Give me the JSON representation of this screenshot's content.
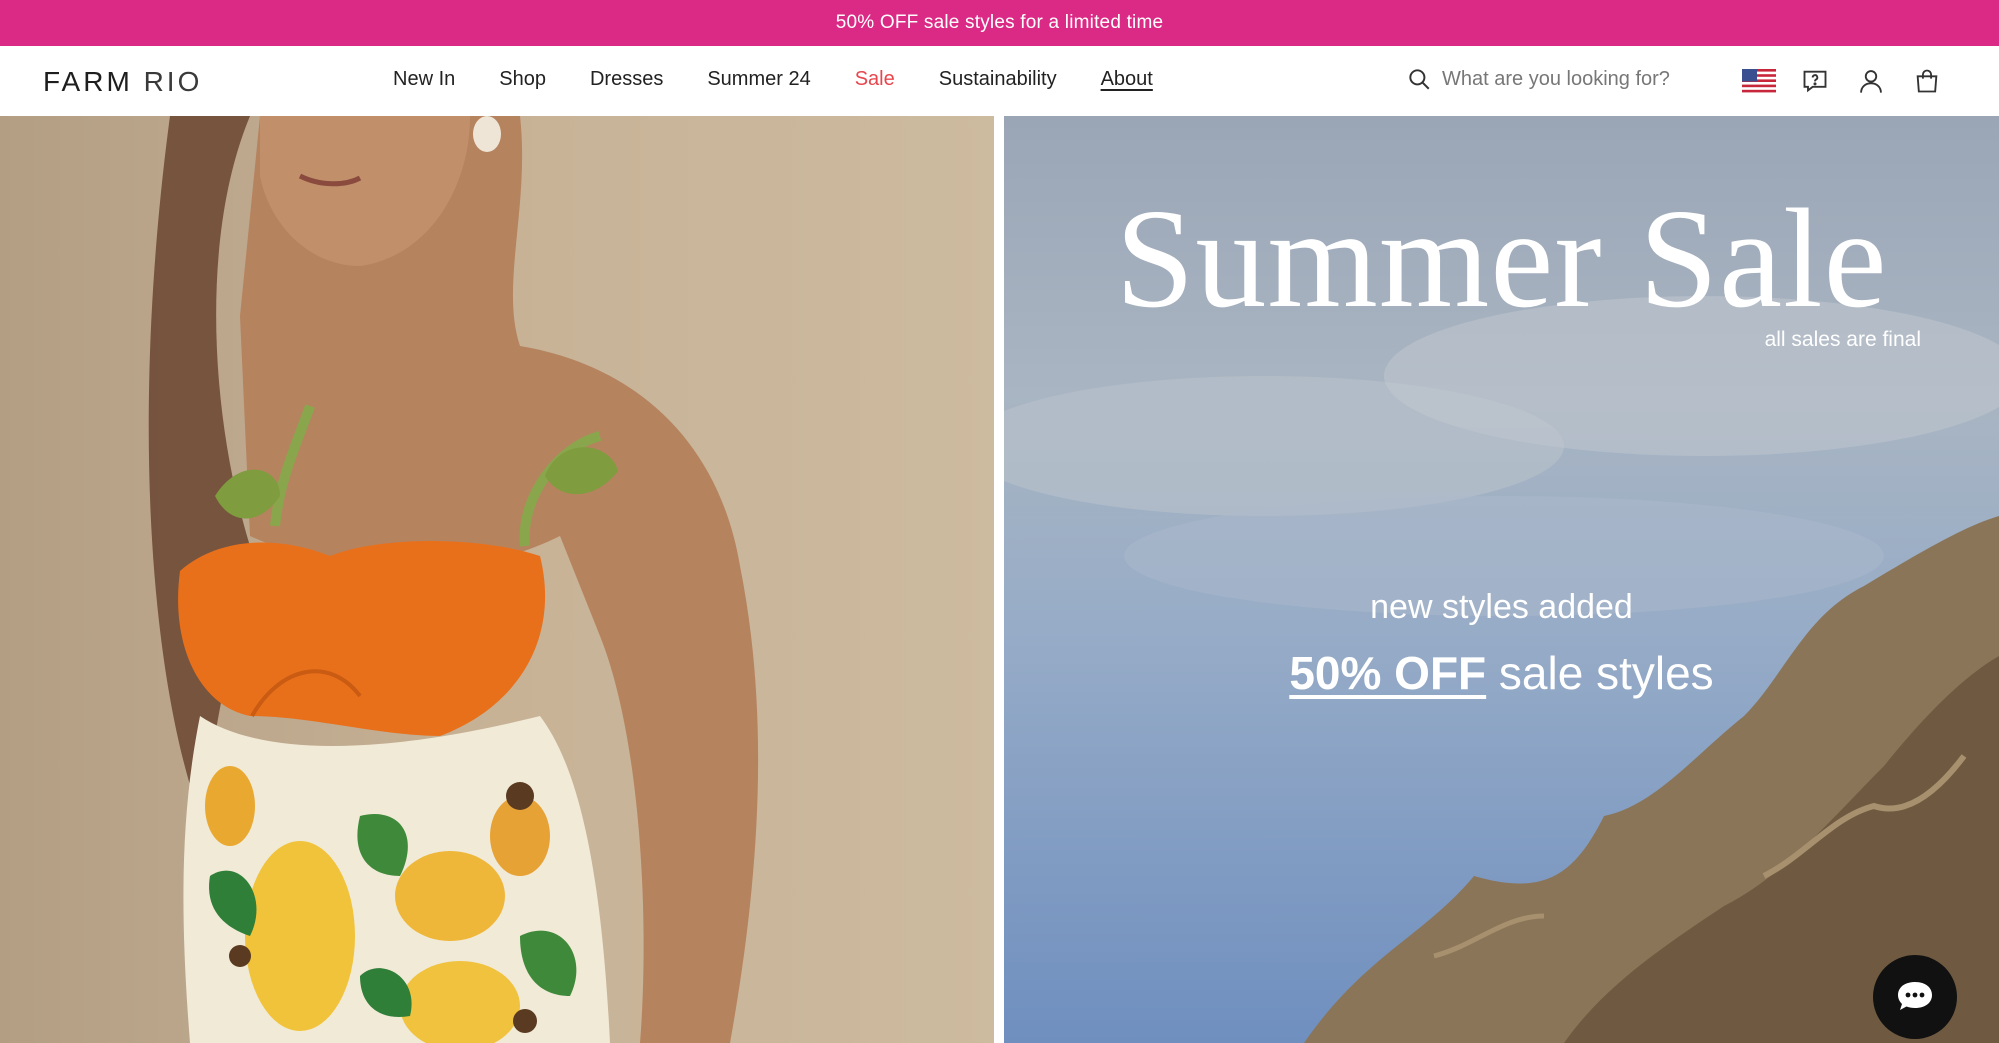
{
  "promo": {
    "text": "50% OFF sale styles for a limited time"
  },
  "header": {
    "logo_farm": "FARM",
    "logo_rio": "RIO",
    "nav": [
      {
        "label": "New In"
      },
      {
        "label": "Shop"
      },
      {
        "label": "Dresses"
      },
      {
        "label": "Summer 24"
      },
      {
        "label": "Sale"
      },
      {
        "label": "Sustainability"
      },
      {
        "label": "About"
      }
    ],
    "search_placeholder": "What are you looking for?",
    "icons": [
      "us-flag-icon",
      "help-icon",
      "account-icon",
      "shopping-bag-icon"
    ]
  },
  "hero": {
    "title": "Summer Sale",
    "note": "all sales are final",
    "subtitle": "new styles added",
    "offer_link": "50% OFF",
    "offer_rest": "sale styles"
  },
  "colors": {
    "promo_bg": "#db2a85",
    "sale_nav": "#e8464d",
    "chat_bg": "#111111"
  }
}
